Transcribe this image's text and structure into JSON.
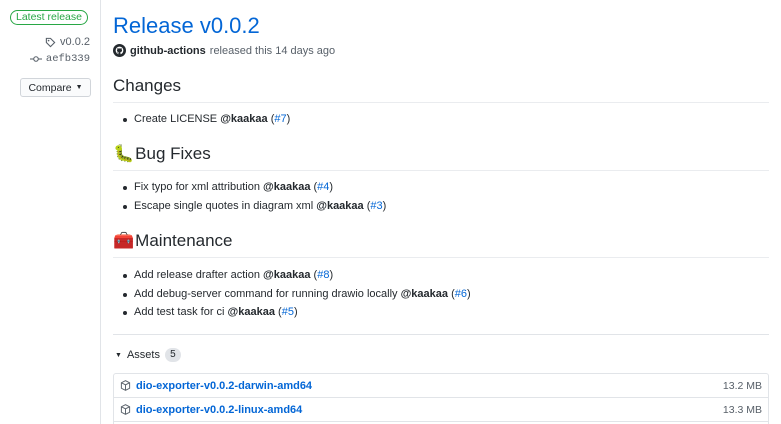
{
  "sidebar": {
    "badge": "Latest release",
    "tag": "v0.0.2",
    "commit": "aefb339",
    "compare_label": "Compare"
  },
  "release": {
    "title": "Release v0.0.2",
    "author": "github-actions",
    "released_text": "released this 14 days ago"
  },
  "sections": {
    "changes": {
      "title": "Changes",
      "items": [
        {
          "text": "Create LICENSE ",
          "user": "@kaakaa",
          "ref": "#7"
        }
      ]
    },
    "bugs": {
      "emoji": "🐛",
      "title": "Bug Fixes",
      "items": [
        {
          "text": "Fix typo for xml attribution ",
          "user": "@kaakaa",
          "ref": "#4"
        },
        {
          "text": "Escape single quotes in diagram xml ",
          "user": "@kaakaa",
          "ref": "#3"
        }
      ]
    },
    "maintenance": {
      "emoji": "🧰",
      "title": "Maintenance",
      "items": [
        {
          "text": "Add release drafter action ",
          "user": "@kaakaa",
          "ref": "#8"
        },
        {
          "text": "Add debug-server command for running drawio locally ",
          "user": "@kaakaa",
          "ref": "#6"
        },
        {
          "text": "Add test task for ci ",
          "user": "@kaakaa",
          "ref": "#5"
        }
      ]
    }
  },
  "assets": {
    "label": "Assets",
    "count": "5",
    "files": [
      {
        "name": "dio-exporter-v0.0.2-darwin-amd64",
        "size": "13.2 MB"
      },
      {
        "name": "dio-exporter-v0.0.2-linux-amd64",
        "size": "13.3 MB"
      }
    ]
  },
  "colors": {
    "link": "#0366d6",
    "badge_green": "#28a745",
    "muted": "#586069"
  }
}
